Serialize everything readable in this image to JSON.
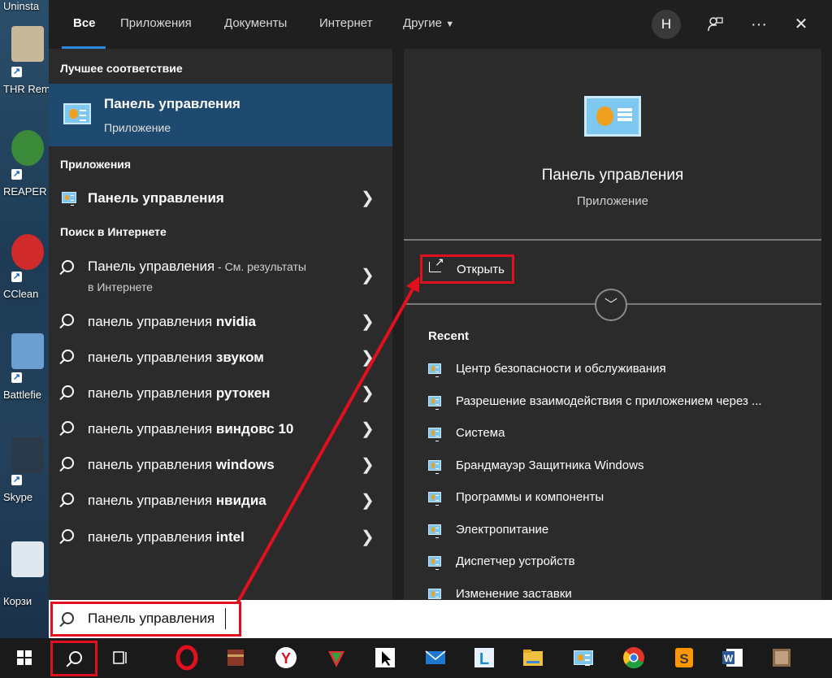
{
  "desktop": {
    "icons": [
      {
        "label": "Uninsta",
        "icon": "uninstall-icon"
      },
      {
        "label": "THR Rem",
        "icon": "yamaha-thr-icon"
      },
      {
        "label": "REAPER",
        "icon": "reaper-icon"
      },
      {
        "label": "CClean",
        "icon": "ccleaner-icon"
      },
      {
        "label": "Battlefie",
        "icon": "battlefield-icon"
      },
      {
        "label": "Skype",
        "icon": "skype-icon"
      },
      {
        "label": "Корзи",
        "icon": "recycle-bin-icon"
      }
    ]
  },
  "tabs": {
    "items": [
      "Все",
      "Приложения",
      "Документы",
      "Интернет",
      "Другие"
    ],
    "active": "Все",
    "avatar_letter": "Н"
  },
  "left": {
    "best_header": "Лучшее соответствие",
    "best": {
      "title": "Панель управления",
      "subtitle": "Приложение"
    },
    "apps_header": "Приложения",
    "apps": [
      {
        "label": "Панель управления"
      }
    ],
    "web_header": "Поиск в Интернете",
    "web_first": {
      "label": "Панель управления",
      "suffix": " - См. результаты",
      "line2": "в Интернете"
    },
    "web": [
      {
        "prefix": "панель управления ",
        "bold": "nvidia"
      },
      {
        "prefix": "панель управления ",
        "bold": "звуком"
      },
      {
        "prefix": "панель управления ",
        "bold": "рутокен"
      },
      {
        "prefix": "панель управления ",
        "bold": "виндовс 10"
      },
      {
        "prefix": "панель управления ",
        "bold": "windows"
      },
      {
        "prefix": "панель управления ",
        "bold": "нвидиа"
      },
      {
        "prefix": "панель управления ",
        "bold": "intel"
      }
    ]
  },
  "right": {
    "title": "Панель управления",
    "subtitle": "Приложение",
    "open_label": "Открыть",
    "recent_header": "Recent",
    "recent": [
      "Центр безопасности и обслуживания",
      "Разрешение взаимодействия с приложением через ...",
      "Система",
      "Брандмауэр Защитника Windows",
      "Программы и компоненты",
      "Электропитание",
      "Диспетчер устройств",
      "Изменение заставки"
    ]
  },
  "search": {
    "value": "Панель управления"
  },
  "taskbar": {
    "apps": [
      "windows-start-icon",
      "search-icon",
      "task-view-icon",
      "opera-icon",
      "archive-icon",
      "yandex-browser-icon",
      "vpn-icon",
      "cursor-app-icon",
      "mail-icon",
      "l-app-icon",
      "file-explorer-icon",
      "control-panel-icon",
      "chrome-icon",
      "sublime-text-icon",
      "word-icon",
      "photo-app-icon"
    ]
  },
  "colors": {
    "accent": "#2e86de",
    "highlight": "#1d4a6e",
    "annotation": "#e01020"
  }
}
